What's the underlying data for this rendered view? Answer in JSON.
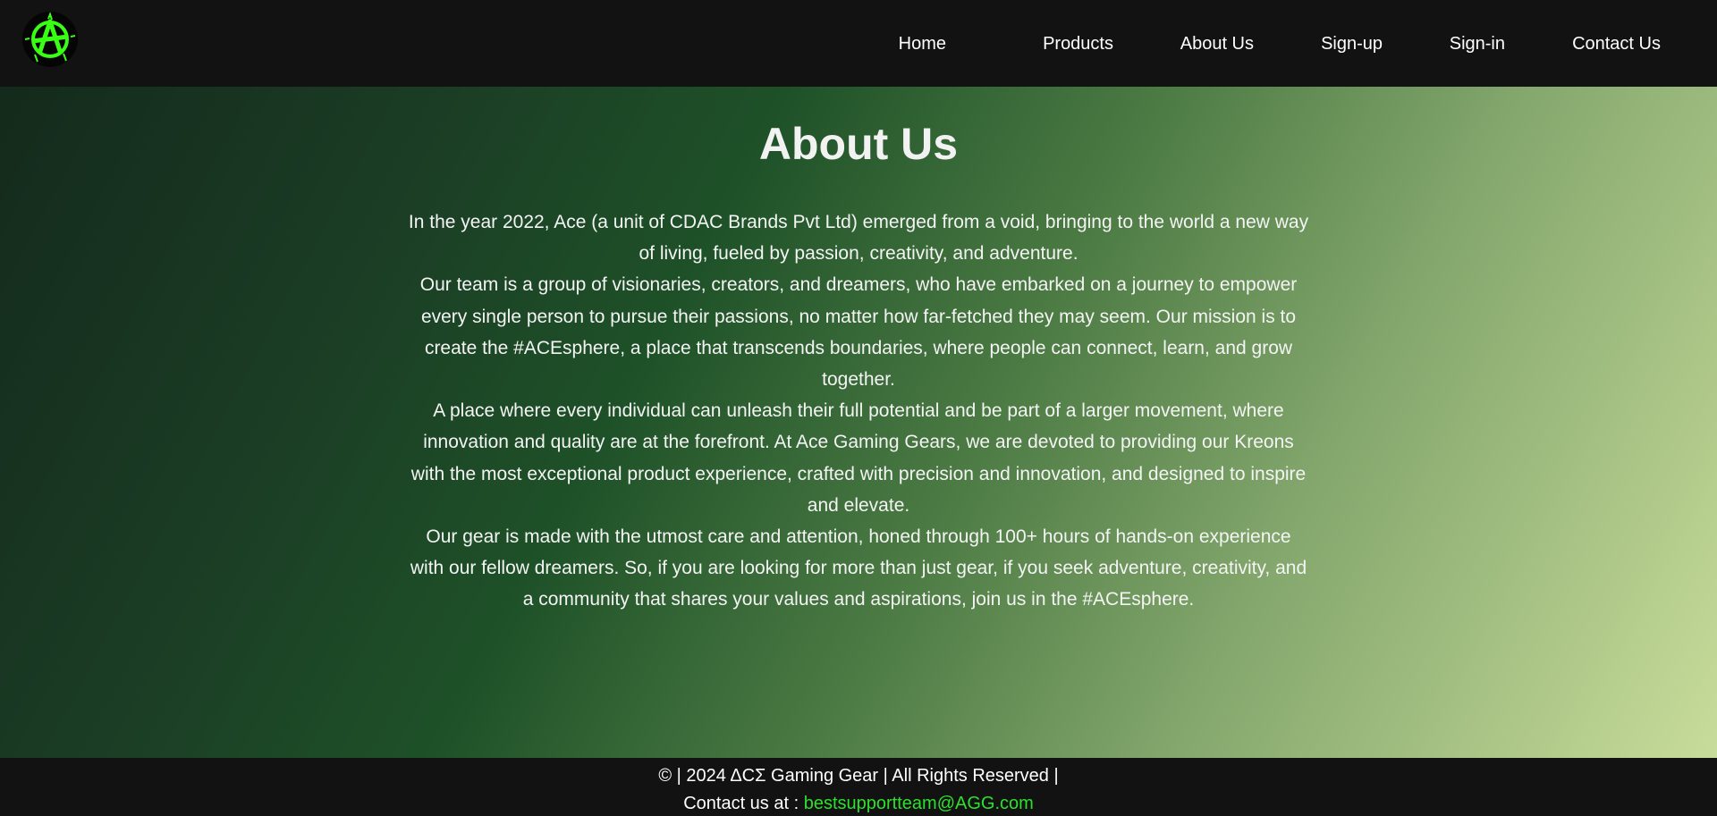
{
  "header": {
    "logo_icon": "anarchy-a-logo-icon",
    "accent_color": "#39ff14",
    "nav": [
      {
        "label": "Home"
      },
      {
        "label": "Products"
      },
      {
        "label": "About Us"
      },
      {
        "label": "Sign-up"
      },
      {
        "label": "Sign-in"
      },
      {
        "label": "Contact Us"
      }
    ]
  },
  "main": {
    "title": "About Us",
    "paragraphs": [
      "In the year 2022, Ace (a unit of CDAC Brands Pvt Ltd) emerged from a void, bringing to the world a new way of living, fueled by passion, creativity, and adventure.",
      "Our team is a group of visionaries, creators, and dreamers, who have embarked on a journey to empower every single person to pursue their passions, no matter how far-fetched they may seem. Our mission is to create the #ACEsphere, a place that transcends boundaries, where people can connect, learn, and grow together.",
      "A place where every individual can unleash their full potential and be part of a larger movement, where innovation and quality are at the forefront. At Ace Gaming Gears, we are devoted to providing our Kreons with the most exceptional product experience, crafted with precision and innovation, and designed to inspire and elevate.",
      "Our gear is made with the utmost care and attention, honed through 100+ hours of hands-on experience with our fellow dreamers. So, if you are looking for more than just gear, if you seek adventure, creativity, and a community that shares your values and aspirations, join us in the #ACEsphere."
    ]
  },
  "footer": {
    "copyright": "© | 2024 ΔCΣ Gaming Gear | All Rights Reserved |",
    "contact_prefix": "Contact us at : ",
    "contact_email": "bestsupportteam@AGG.com",
    "email_color": "#2ee02e"
  }
}
